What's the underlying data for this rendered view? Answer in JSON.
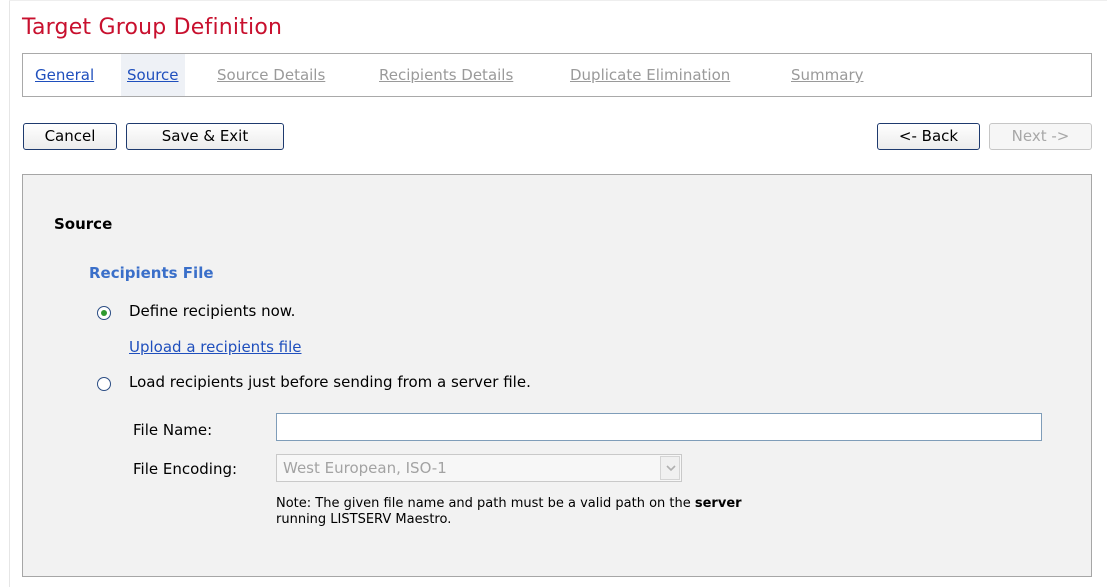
{
  "page": {
    "title": "Target Group Definition"
  },
  "steps": [
    {
      "label": "General",
      "state": "link"
    },
    {
      "label": "Source",
      "state": "current"
    },
    {
      "label": "Source Details",
      "state": "disabled"
    },
    {
      "label": "Recipients Details",
      "state": "disabled"
    },
    {
      "label": "Duplicate Elimination",
      "state": "disabled"
    },
    {
      "label": "Summary",
      "state": "disabled"
    }
  ],
  "toolbar": {
    "cancel_label": "Cancel",
    "save_exit_label": "Save & Exit",
    "back_label": "<- Back",
    "next_label": "Next ->"
  },
  "source": {
    "section_title": "Source",
    "group_title": "Recipients File",
    "options": [
      {
        "label": "Define recipients now.",
        "checked": true
      },
      {
        "label": "Load recipients just before sending from a server file.",
        "checked": false
      }
    ],
    "upload_link": "Upload a recipients file",
    "file_name": {
      "label": "File Name:",
      "value": ""
    },
    "file_encoding": {
      "label": "File Encoding:",
      "value": "West European, ISO-1"
    },
    "note": {
      "prefix": "Note: The given file name and path must be a valid path on the ",
      "emphasis": "server",
      "suffix": "running LISTSERV Maestro."
    }
  },
  "colors": {
    "title": "#c8102e",
    "link": "#1f4fbd",
    "group_title": "#3a6fc9",
    "panel_bg": "#f2f2f2",
    "radio_dot": "#2f9a2f"
  }
}
